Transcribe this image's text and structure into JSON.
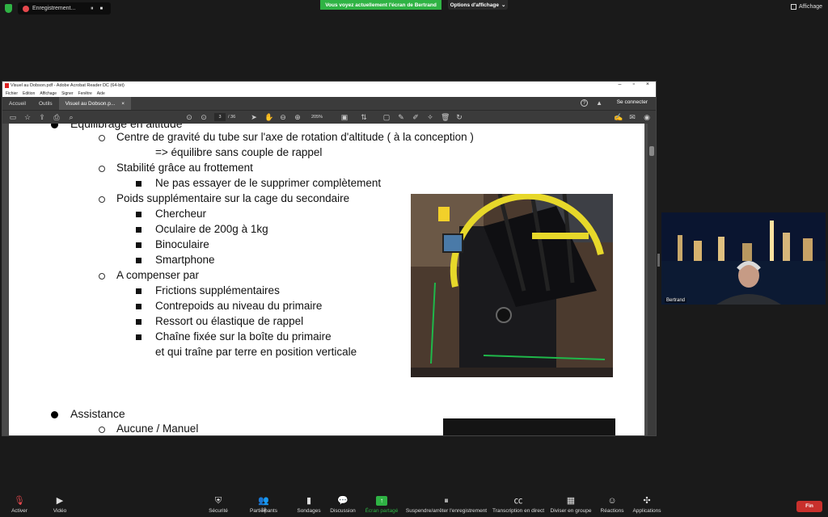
{
  "zoom_top": {
    "recording_label": "Enregistrement...",
    "share_banner": "Vous voyez actuellement l'écran de Bertrand",
    "view_options": "Options d'affichage",
    "view_options_arrow": "⌄",
    "affichage": "Affichage",
    "pause_glyph": "⏸",
    "stop_glyph": "■"
  },
  "acrobat": {
    "title": "Visuel au Dobson.pdf - Adobe Acrobat Reader DC (64-bit)",
    "menu": [
      "Fichier",
      "Edition",
      "Affichage",
      "Signer",
      "Fenêtre",
      "Aide"
    ],
    "tabs": {
      "home": "Accueil",
      "tools": "Outils",
      "doc": "Visuel au Dobson.p...",
      "close": "×"
    },
    "connect": "Se connecter",
    "page_current": "3",
    "page_total": "/ 36",
    "zoom": "205%"
  },
  "slide": {
    "heading_partial": "Equilibrage en altitude",
    "items": [
      {
        "level": 2,
        "text": "Centre de gravité du tube sur l'axe de rotation d'altitude ( à la conception )"
      },
      {
        "level": 3,
        "text": "=> équilibre sans couple de rappel"
      },
      {
        "level": 2,
        "text": "Stabilité grâce au frottement"
      },
      {
        "level": 3,
        "text": "Ne pas essayer de le supprimer complètement"
      },
      {
        "level": 2,
        "text": "Poids supplémentaire sur la cage du secondaire"
      },
      {
        "level": 3,
        "text": "Chercheur"
      },
      {
        "level": 3,
        "text": "Oculaire de 200g à 1kg"
      },
      {
        "level": 3,
        "text": "Binoculaire"
      },
      {
        "level": 3,
        "text": "Smartphone"
      },
      {
        "level": 2,
        "text": "A compenser par"
      },
      {
        "level": 3,
        "text": "Frictions supplémentaires"
      },
      {
        "level": 3,
        "text": "Contrepoids au niveau du primaire"
      },
      {
        "level": 3,
        "text": "Ressort ou élastique de rappel"
      },
      {
        "level": 3,
        "text": "Chaîne fixée sur la boîte du primaire"
      },
      {
        "level": 3,
        "text": "et qui traîne par terre en position verticale"
      }
    ],
    "assist_heading": "Assistance",
    "assist_sub": "Aucune / Manuel"
  },
  "video": {
    "name": "Bertrand"
  },
  "toolbar": {
    "mute": "Activer",
    "video": "Vidéo",
    "security": "Sécurité",
    "participants": "Participants",
    "participants_count": "18",
    "polls": "Sondages",
    "chat": "Discussion",
    "share": "Écran partagé",
    "recording": "Suspendre/arrêter l'enregistrement",
    "transcription": "Transcription en direct",
    "breakout": "Diviser en groupe",
    "reactions": "Réactions",
    "apps": "Applications",
    "end": "Fin"
  },
  "colors": {
    "share_green": "#2fb344",
    "end_red": "#c9302c",
    "acrobat_dark": "#3b3b3b"
  }
}
